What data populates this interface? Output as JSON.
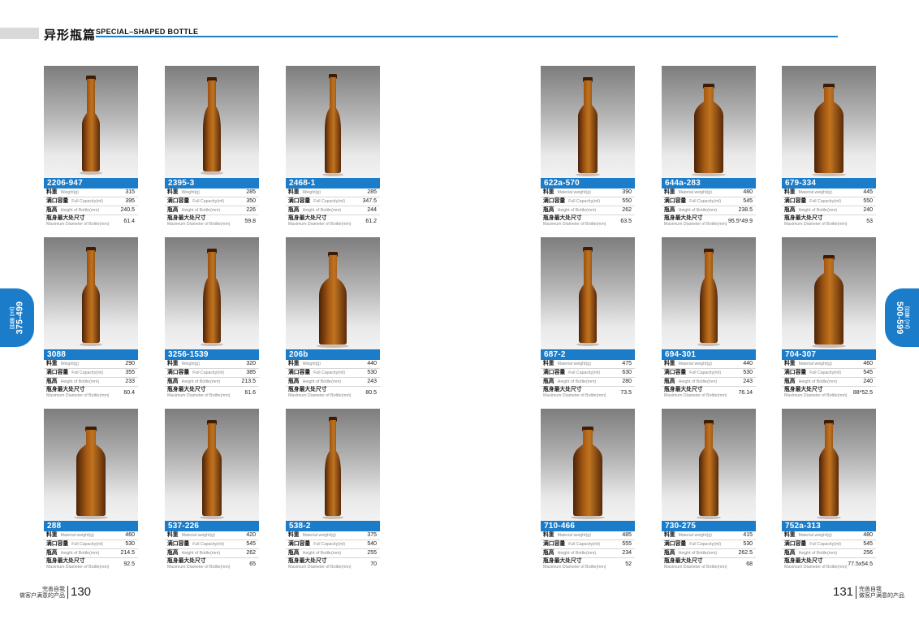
{
  "header": {
    "title_zh": "异形瓶篇",
    "title_en": "SPECIAL–SHAPED BOTTLE"
  },
  "side_tabs": {
    "left": {
      "range": "375-499",
      "unit": "容量 (ml)"
    },
    "right": {
      "range": "500-599",
      "unit": "容量 (ml)"
    }
  },
  "footer": {
    "left": {
      "slogan_1": "完善自我",
      "slogan_2": "做客户满意的产品",
      "page": "130"
    },
    "right": {
      "slogan_1": "完善自我",
      "slogan_2": "做客户满意的产品",
      "page": "131"
    }
  },
  "products": [
    {
      "code": "2206-947",
      "shape": "longneck",
      "specs": [
        {
          "zh": "料重",
          "en": "Weight(g)",
          "val": "315"
        },
        {
          "zh": "满口容量",
          "en": "Full Capacity(ml)",
          "val": "395"
        },
        {
          "zh": "瓶高",
          "en": "Height of Bottle(mm)",
          "val": "240.5"
        },
        {
          "zh": "瓶身最大处尺寸",
          "en": "Maximum Diameter of Bottle(mm)",
          "val": "61.4"
        }
      ]
    },
    {
      "code": "2395-3",
      "shape": "tapered",
      "specs": [
        {
          "zh": "料重",
          "en": "Weight(g)",
          "val": "285"
        },
        {
          "zh": "满口容量",
          "en": "Full Capacity(ml)",
          "val": "350"
        },
        {
          "zh": "瓶高",
          "en": "Height of Bottle(mm)",
          "val": "226"
        },
        {
          "zh": "瓶身最大处尺寸",
          "en": "Maximum Diameter of Bottle(mm)",
          "val": "59.8"
        }
      ]
    },
    {
      "code": "2468-1",
      "shape": "slim",
      "specs": [
        {
          "zh": "料重",
          "en": "Weight(g)",
          "val": "285"
        },
        {
          "zh": "满口容量",
          "en": "Full Capacity(ml)",
          "val": "347.5"
        },
        {
          "zh": "瓶高",
          "en": "Height of Bottle(mm)",
          "val": "244"
        },
        {
          "zh": "瓶身最大处尺寸",
          "en": "Maximum Diameter of Bottle(mm)",
          "val": "61.2"
        }
      ]
    },
    {
      "code": "622a-570",
      "shape": "square",
      "specs": [
        {
          "zh": "料重",
          "en": "Material weight(g)",
          "val": "390"
        },
        {
          "zh": "满口容量",
          "en": "Full Capacity(ml)",
          "val": "550"
        },
        {
          "zh": "瓶高",
          "en": "Height of Bottle(mm)",
          "val": "262"
        },
        {
          "zh": "瓶身最大处尺寸",
          "en": "Maximum Diameter of Bottle(mm)",
          "val": "63.5"
        }
      ]
    },
    {
      "code": "644a-283",
      "shape": "flask",
      "specs": [
        {
          "zh": "料重",
          "en": "Material weight(g)",
          "val": "480"
        },
        {
          "zh": "满口容量",
          "en": "Full Capacity(ml)",
          "val": "545"
        },
        {
          "zh": "瓶高",
          "en": "Height of Bottle(mm)",
          "val": "238.5"
        },
        {
          "zh": "瓶身最大处尺寸",
          "en": "Maximum Diameter of Bottle(mm)",
          "val": "95.5*49.9"
        }
      ]
    },
    {
      "code": "679-334",
      "shape": "flask",
      "specs": [
        {
          "zh": "料重",
          "en": "Material weight(g)",
          "val": "445"
        },
        {
          "zh": "满口容量",
          "en": "Full Capacity(ml)",
          "val": "550"
        },
        {
          "zh": "瓶高",
          "en": "Height of Bottle(mm)",
          "val": "240"
        },
        {
          "zh": "瓶身最大处尺寸",
          "en": "Maximum Diameter of Bottle(mm)",
          "val": "53"
        }
      ]
    },
    {
      "code": "3088",
      "shape": "longneck",
      "specs": [
        {
          "zh": "料重",
          "en": "Weight(g)",
          "val": "290"
        },
        {
          "zh": "满口容量",
          "en": "Full Capacity(ml)",
          "val": "355"
        },
        {
          "zh": "瓶高",
          "en": "Height of Bottle(mm)",
          "val": "233"
        },
        {
          "zh": "瓶身最大处尺寸",
          "en": "Maximum Diameter of Bottle(mm)",
          "val": "60.4"
        }
      ]
    },
    {
      "code": "3256-1539",
      "shape": "tapered",
      "specs": [
        {
          "zh": "料重",
          "en": "Weight(g)",
          "val": "320"
        },
        {
          "zh": "满口容量",
          "en": "Full Capacity(ml)",
          "val": "385"
        },
        {
          "zh": "瓶高",
          "en": "Height of Bottle(mm)",
          "val": "213.5"
        },
        {
          "zh": "瓶身最大处尺寸",
          "en": "Maximum Diameter of Bottle(mm)",
          "val": "61.6"
        }
      ]
    },
    {
      "code": "206b",
      "shape": "wine",
      "specs": [
        {
          "zh": "料重",
          "en": "Weight(g)",
          "val": "440"
        },
        {
          "zh": "满口容量",
          "en": "Full Capacity(ml)",
          "val": "530"
        },
        {
          "zh": "瓶高",
          "en": "Height of Bottle(mm)",
          "val": "243"
        },
        {
          "zh": "瓶身最大处尺寸",
          "en": "Maximum Diameter of Bottle(mm)",
          "val": "80.5"
        }
      ]
    },
    {
      "code": "687-2",
      "shape": "longneck",
      "specs": [
        {
          "zh": "料重",
          "en": "Material weight(g)",
          "val": "475"
        },
        {
          "zh": "满口容量",
          "en": "Full Capacity(ml)",
          "val": "630"
        },
        {
          "zh": "瓶高",
          "en": "Height of Bottle(mm)",
          "val": "280"
        },
        {
          "zh": "瓶身最大处尺寸",
          "en": "Maximum Diameter of Bottle(mm)",
          "val": "73.5"
        }
      ]
    },
    {
      "code": "694-301",
      "shape": "tapered",
      "specs": [
        {
          "zh": "料重",
          "en": "Material weight(g)",
          "val": "440"
        },
        {
          "zh": "满口容量",
          "en": "Full Capacity(ml)",
          "val": "530"
        },
        {
          "zh": "瓶高",
          "en": "Height of Bottle(mm)",
          "val": "243"
        },
        {
          "zh": "瓶身最大处尺寸",
          "en": "Maximum Diameter of Bottle(mm)",
          "val": "76.14"
        }
      ]
    },
    {
      "code": "704-307",
      "shape": "flask",
      "specs": [
        {
          "zh": "料重",
          "en": "Material weight(g)",
          "val": "460"
        },
        {
          "zh": "满口容量",
          "en": "Full Capacity(ml)",
          "val": "545"
        },
        {
          "zh": "瓶高",
          "en": "Height of Bottle(mm)",
          "val": "240"
        },
        {
          "zh": "瓶身最大处尺寸",
          "en": "Maximum Diameter of Bottle(mm)",
          "val": "88*52.5"
        }
      ]
    },
    {
      "code": "288",
      "shape": "flask",
      "specs": [
        {
          "zh": "料重",
          "en": "Material weight(g)",
          "val": "460"
        },
        {
          "zh": "满口容量",
          "en": "Full Capacity(ml)",
          "val": "530"
        },
        {
          "zh": "瓶高",
          "en": "Height of Bottle(mm)",
          "val": "214.5"
        },
        {
          "zh": "瓶身最大处尺寸",
          "en": "Maximum Diameter of Bottle(mm)",
          "val": "92.5"
        }
      ]
    },
    {
      "code": "537-226",
      "shape": "square",
      "specs": [
        {
          "zh": "料重",
          "en": "Material weight(g)",
          "val": "420"
        },
        {
          "zh": "满口容量",
          "en": "Full Capacity(ml)",
          "val": "545"
        },
        {
          "zh": "瓶高",
          "en": "Height of Bottle(mm)",
          "val": "262"
        },
        {
          "zh": "瓶身最大处尺寸",
          "en": "Maximum Diameter of Bottle(mm)",
          "val": "65"
        }
      ]
    },
    {
      "code": "538-2",
      "shape": "slim",
      "specs": [
        {
          "zh": "料重",
          "en": "Material weight(g)",
          "val": "375"
        },
        {
          "zh": "满口容量",
          "en": "Full Capacity(ml)",
          "val": "540"
        },
        {
          "zh": "瓶高",
          "en": "Height of Bottle(mm)",
          "val": "255"
        },
        {
          "zh": "瓶身最大处尺寸",
          "en": "Maximum Diameter of Bottle(mm)",
          "val": "70"
        }
      ]
    },
    {
      "code": "710-466",
      "shape": "flask",
      "specs": [
        {
          "zh": "料重",
          "en": "Material weight(g)",
          "val": "485"
        },
        {
          "zh": "满口容量",
          "en": "Full Capacity(ml)",
          "val": "555"
        },
        {
          "zh": "瓶高",
          "en": "Height of Bottle(mm)",
          "val": "234"
        },
        {
          "zh": "瓶身最大处尺寸",
          "en": "Maximum Diameter of Bottle(mm)",
          "val": "52"
        }
      ]
    },
    {
      "code": "730-275",
      "shape": "square",
      "specs": [
        {
          "zh": "料重",
          "en": "Material weight(g)",
          "val": "415"
        },
        {
          "zh": "满口容量",
          "en": "Full Capacity(ml)",
          "val": "530"
        },
        {
          "zh": "瓶高",
          "en": "Height of Bottle(mm)",
          "val": "262.5"
        },
        {
          "zh": "瓶身最大处尺寸",
          "en": "Maximum Diameter of Bottle(mm)",
          "val": "68"
        }
      ]
    },
    {
      "code": "752a-313",
      "shape": "square",
      "specs": [
        {
          "zh": "料重",
          "en": "Material weight(g)",
          "val": "480"
        },
        {
          "zh": "满口容量",
          "en": "Full Capacity(ml)",
          "val": "545"
        },
        {
          "zh": "瓶高",
          "en": "Height of Bottle(mm)",
          "val": "256"
        },
        {
          "zh": "瓶身最大处尺寸",
          "en": "Maximum Diameter of Bottle(mm)",
          "val": "77.5x54.5"
        }
      ]
    }
  ]
}
